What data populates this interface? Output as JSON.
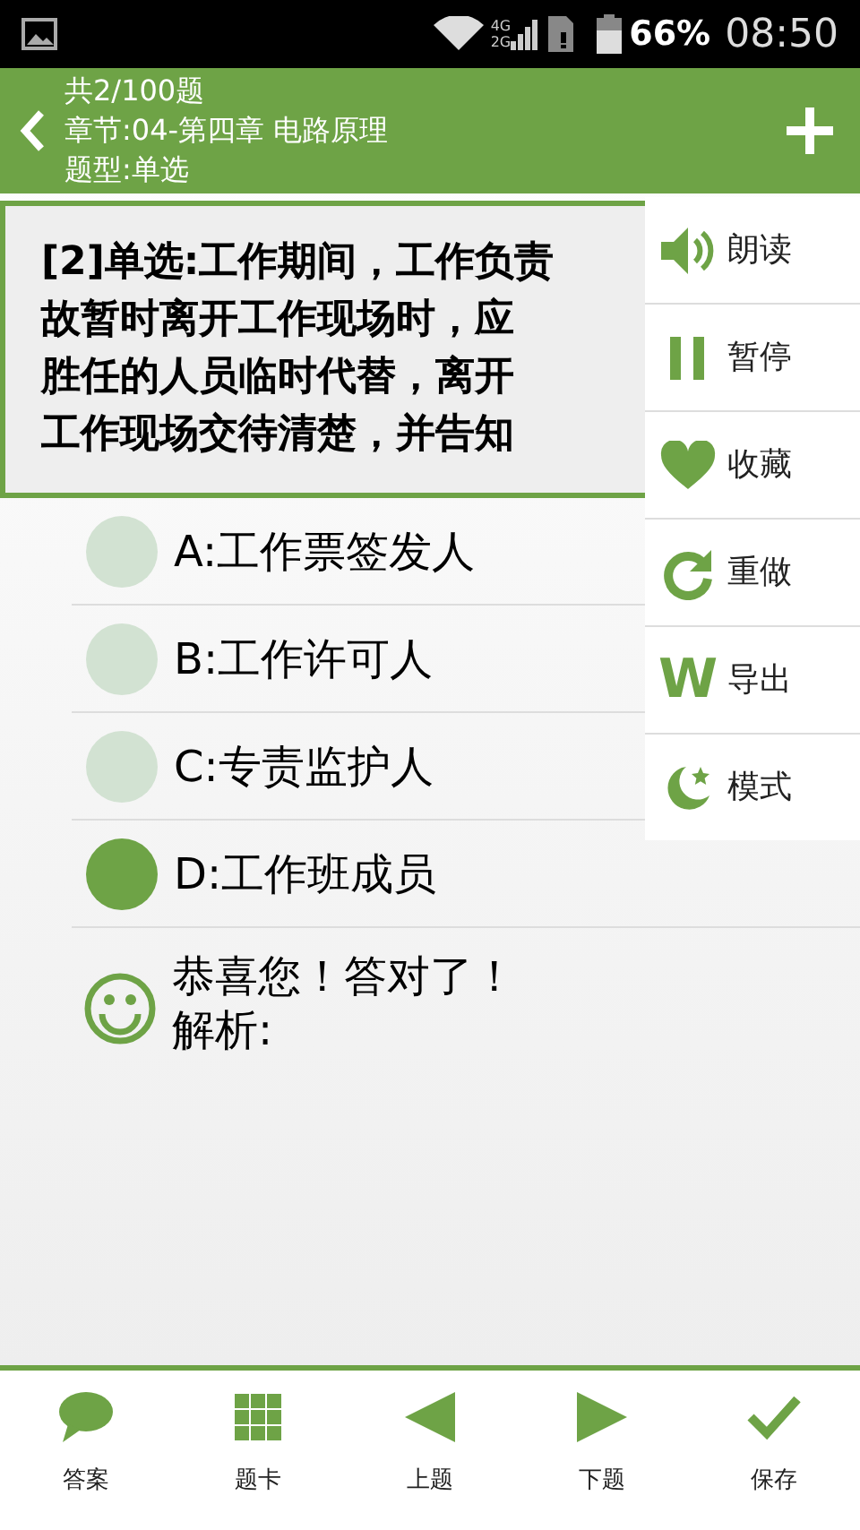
{
  "status_bar": {
    "net_top": "4G",
    "net_bottom": "2G",
    "battery": "66%",
    "time": "08:50"
  },
  "header": {
    "lines": [
      "共2/100题",
      "章节:04-第四章 电路原理",
      "题型:单选"
    ]
  },
  "question": {
    "lines": [
      "[2]单选:工作期间，工作负责",
      "故暂时离开工作现场时，应",
      "胜任的人员临时代替，离开",
      "工作现场交待清楚，并告知"
    ]
  },
  "options": [
    {
      "label": "A:工作票签发人",
      "selected": false
    },
    {
      "label": "B:工作许可人",
      "selected": false
    },
    {
      "label": "C:专责监护人",
      "selected": false
    },
    {
      "label": "D:工作班成员",
      "selected": true
    }
  ],
  "result": {
    "message": "恭喜您！答对了！",
    "analysis": "解析:"
  },
  "menu": [
    {
      "kind": "speaker",
      "label": "朗读"
    },
    {
      "kind": "pause",
      "label": "暂停"
    },
    {
      "kind": "heart",
      "label": "收藏"
    },
    {
      "kind": "redo",
      "label": "重做"
    },
    {
      "kind": "export",
      "glyph": "W",
      "label": "导出"
    },
    {
      "kind": "mode",
      "label": "模式"
    }
  ],
  "bottom_nav": [
    {
      "kind": "bubble",
      "label": "答案"
    },
    {
      "kind": "grid",
      "label": "题卡"
    },
    {
      "kind": "prev",
      "label": "上题"
    },
    {
      "kind": "next",
      "label": "下题"
    },
    {
      "kind": "check",
      "label": "保存"
    }
  ]
}
